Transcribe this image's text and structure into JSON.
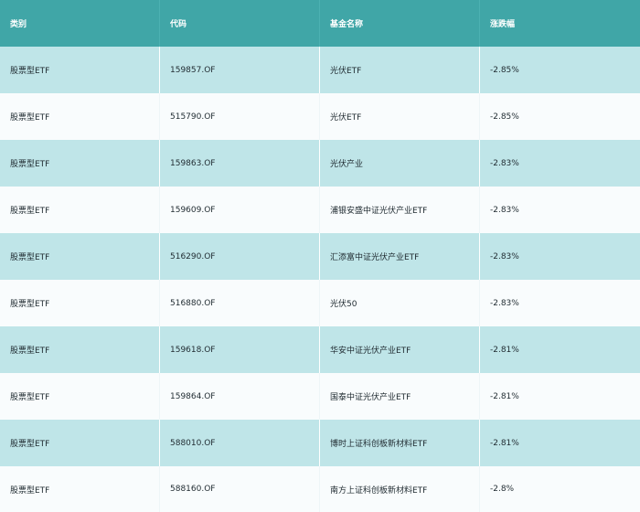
{
  "table": {
    "headers": [
      "类别",
      "代码",
      "基金名称",
      "涨跌幅"
    ],
    "rows": [
      [
        "股票型ETF",
        "159857.OF",
        "光伏ETF",
        "-2.85%"
      ],
      [
        "股票型ETF",
        "515790.OF",
        "光伏ETF",
        "-2.85%"
      ],
      [
        "股票型ETF",
        "159863.OF",
        "光伏产业",
        "-2.83%"
      ],
      [
        "股票型ETF",
        "159609.OF",
        "浦银安盛中证光伏产业ETF",
        "-2.83%"
      ],
      [
        "股票型ETF",
        "516290.OF",
        "汇添富中证光伏产业ETF",
        "-2.83%"
      ],
      [
        "股票型ETF",
        "516880.OF",
        "光伏50",
        "-2.83%"
      ],
      [
        "股票型ETF",
        "159618.OF",
        "华安中证光伏产业ETF",
        "-2.81%"
      ],
      [
        "股票型ETF",
        "159864.OF",
        "国泰中证光伏产业ETF",
        "-2.81%"
      ],
      [
        "股票型ETF",
        "588010.OF",
        "博时上证科创板新材料ETF",
        "-2.81%"
      ],
      [
        "股票型ETF",
        "588160.OF",
        "南方上证科创板新材料ETF",
        "-2.8%"
      ]
    ]
  },
  "colors": {
    "header_bg": "#40a6a7",
    "row_odd_bg": "#bfe5e8",
    "row_even_bg": "#f9fcfd"
  }
}
